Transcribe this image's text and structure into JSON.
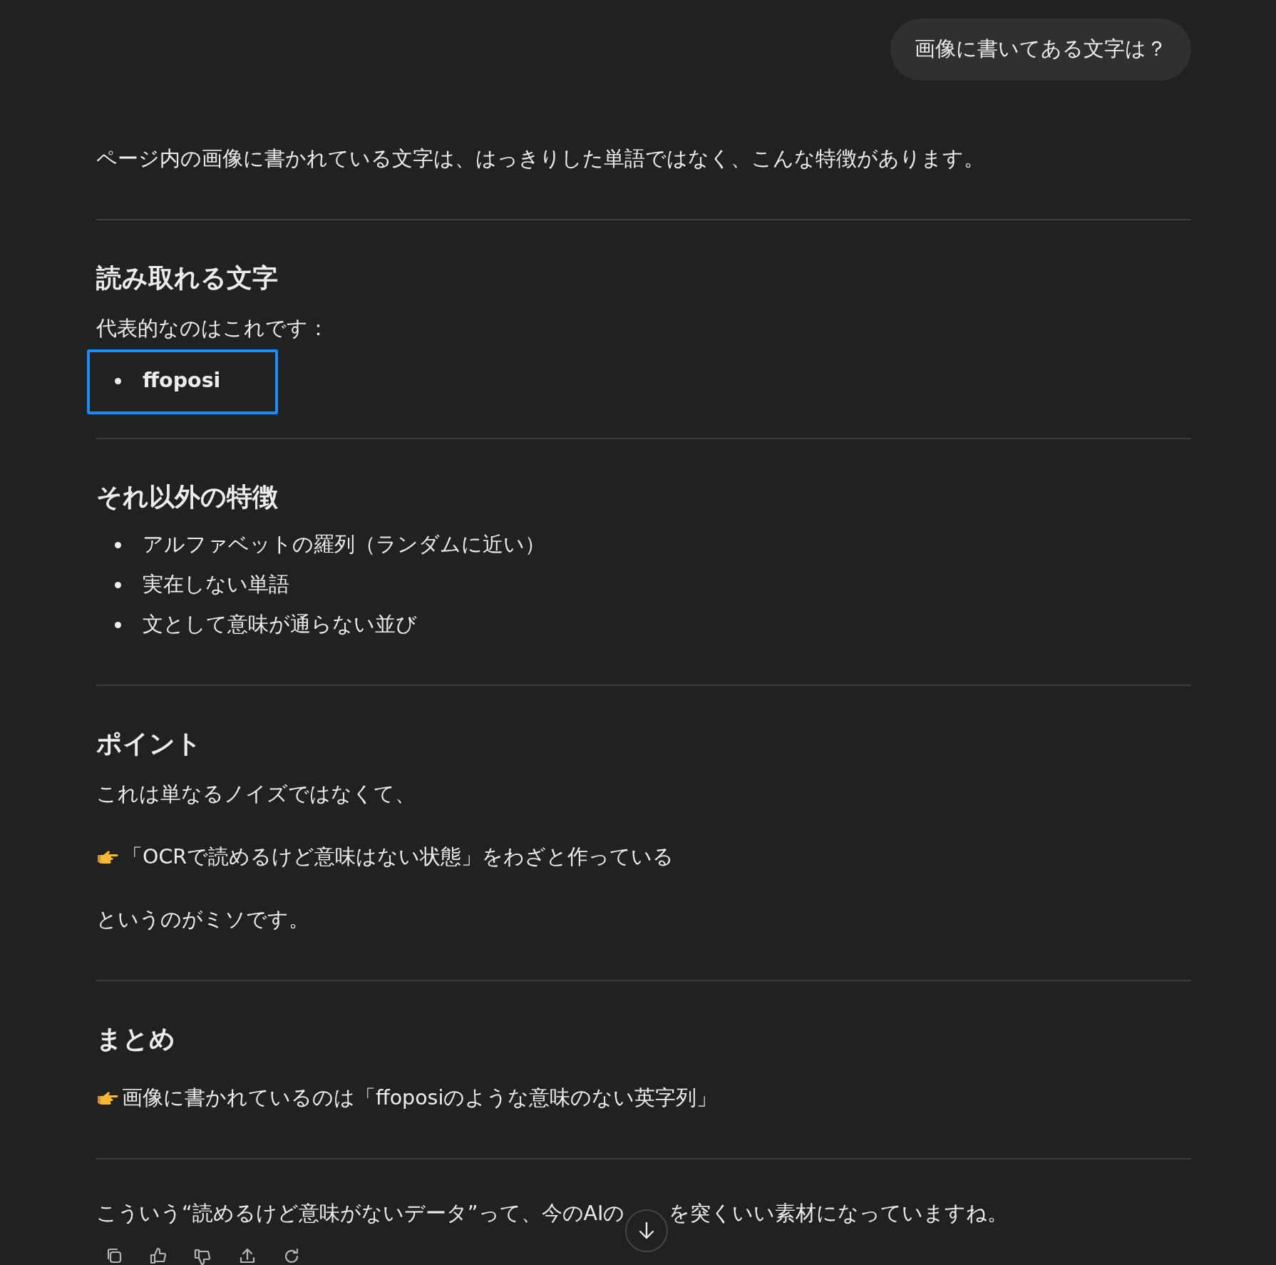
{
  "user_message": {
    "text": "画像に書いてある文字は？"
  },
  "blocks": [
    {
      "kind": "paragraph",
      "text": "ページ内の画像に書かれている文字は、はっきりした単語ではなく、こんな特徴があります。"
    },
    {
      "kind": "divider"
    },
    {
      "kind": "heading",
      "text": "読み取れる文字"
    },
    {
      "kind": "paragraph",
      "text": "代表的なのはこれです："
    },
    {
      "kind": "list",
      "highlighted": true,
      "items": [
        {
          "text": "ffoposi",
          "bold": true
        }
      ]
    },
    {
      "kind": "divider"
    },
    {
      "kind": "heading",
      "text": "それ以外の特徴"
    },
    {
      "kind": "list",
      "highlighted": false,
      "items": [
        {
          "text": "アルファベットの羅列（ランダムに近い）",
          "bold": false
        },
        {
          "text": "実在しない単語",
          "bold": false
        },
        {
          "text": "文として意味が通らない並び",
          "bold": false
        }
      ]
    },
    {
      "kind": "divider"
    },
    {
      "kind": "heading",
      "text": "ポイント"
    },
    {
      "kind": "paragraph",
      "text": "これは単なるノイズではなくて、"
    },
    {
      "kind": "pointer",
      "text": "「OCRで読めるけど意味はない状態」をわざと作っている"
    },
    {
      "kind": "paragraph",
      "text": "というのがミソです。"
    },
    {
      "kind": "divider"
    },
    {
      "kind": "heading",
      "text": "まとめ"
    },
    {
      "kind": "pointer",
      "text": "画像に書かれているのは「ffoposiのような意味のない英字列」"
    },
    {
      "kind": "divider"
    },
    {
      "kind": "covered_paragraph",
      "parts": [
        "こういう“読めるけど意味がないデータ”って、今のAIの",
        "を突くいい素材になっていますね。"
      ]
    }
  ]
}
